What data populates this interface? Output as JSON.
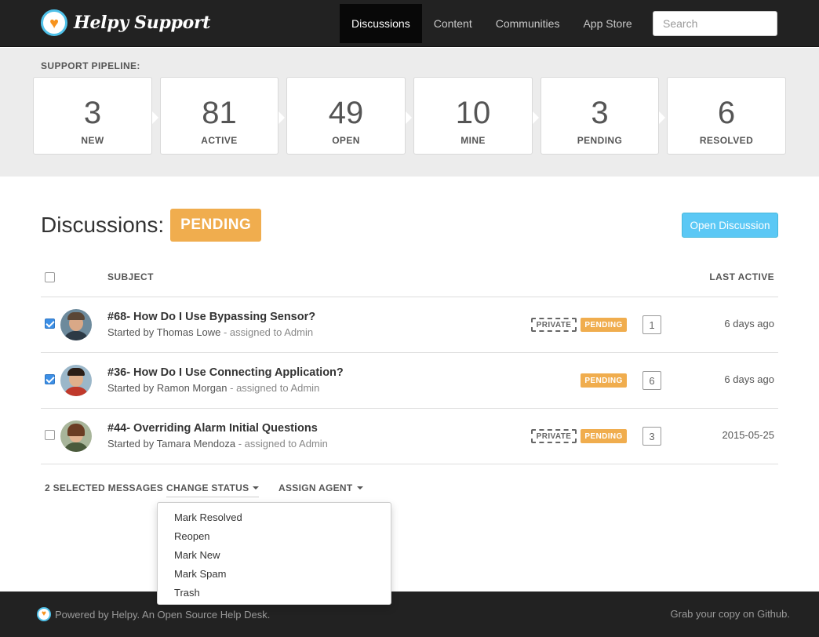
{
  "brand": {
    "name": "Helpy Support",
    "logo_icon": "heart-logo-icon"
  },
  "nav": {
    "items": [
      {
        "label": "Discussions",
        "active": true
      },
      {
        "label": "Content",
        "active": false
      },
      {
        "label": "Communities",
        "active": false
      },
      {
        "label": "App Store",
        "active": false
      }
    ]
  },
  "search": {
    "placeholder": "Search",
    "value": ""
  },
  "pipeline": {
    "title": "SUPPORT PIPELINE:",
    "stats": [
      {
        "count": "3",
        "label": "NEW"
      },
      {
        "count": "81",
        "label": "ACTIVE"
      },
      {
        "count": "49",
        "label": "OPEN"
      },
      {
        "count": "10",
        "label": "MINE"
      },
      {
        "count": "3",
        "label": "PENDING"
      },
      {
        "count": "6",
        "label": "RESOLVED"
      }
    ]
  },
  "discussions": {
    "heading": "Discussions:",
    "status": "PENDING",
    "open_button": "Open Discussion",
    "columns": {
      "subject": "SUBJECT",
      "last_active": "LAST ACTIVE"
    },
    "rows": [
      {
        "checked": true,
        "subject": "#68- How Do I Use Bypassing Sensor?",
        "started_by_prefix": "Started by",
        "author": "Thomas Lowe",
        "assigned": "- assigned to Admin",
        "private": true,
        "private_label": "PRIVATE",
        "status_label": "PENDING",
        "replies": "1",
        "last_active": "6 days ago"
      },
      {
        "checked": true,
        "subject": "#36- How Do I Use Connecting Application?",
        "started_by_prefix": "Started by",
        "author": "Ramon Morgan",
        "assigned": "- assigned to Admin",
        "private": false,
        "private_label": "",
        "status_label": "PENDING",
        "replies": "6",
        "last_active": "6 days ago"
      },
      {
        "checked": false,
        "subject": "#44- Overriding Alarm Initial Questions",
        "started_by_prefix": "Started by",
        "author": "Tamara Mendoza",
        "assigned": "- assigned to Admin",
        "private": true,
        "private_label": "PRIVATE",
        "status_label": "PENDING",
        "replies": "3",
        "last_active": "2015-05-25"
      }
    ]
  },
  "bulk": {
    "selected": "2 SELECTED MESSAGES",
    "change_status": "CHANGE STATUS",
    "assign_agent": "ASSIGN AGENT",
    "status_options": [
      "Mark Resolved",
      "Reopen",
      "Mark New",
      "Mark Spam",
      "Trash"
    ]
  },
  "footer": {
    "left": "Powered by Helpy. An Open Source Help Desk.",
    "right": "Grab your copy on Github."
  },
  "colors": {
    "nav_bg": "#222222",
    "pending": "#f0ad4e",
    "accent": "#5bc8f5",
    "logo_ring": "#4fc1e9",
    "logo_heart": "#f7931e"
  }
}
